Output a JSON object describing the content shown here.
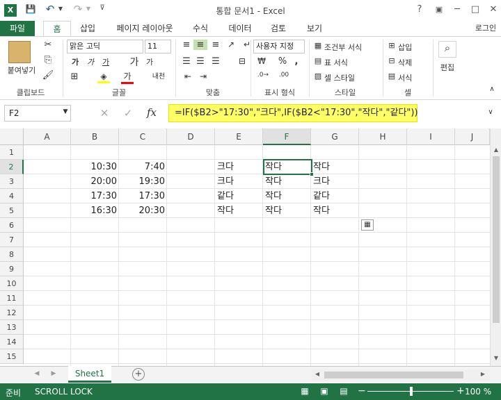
{
  "window": {
    "title": "통합 문서1 - Excel",
    "help": "?",
    "minimize": "─",
    "restore": "□",
    "close": "✕",
    "user": "로그인"
  },
  "qat": {
    "save": "💾",
    "undo": "↶",
    "redo": "↷"
  },
  "tabs": [
    "파일",
    "홈",
    "삽입",
    "페이지 레이아웃",
    "수식",
    "데이터",
    "검토",
    "보기"
  ],
  "ribbon": {
    "paste_label": "붙여넣기",
    "clipboard_group": "클립보드",
    "font_name": "맑은 고딕",
    "font_size": "11",
    "bold": "가",
    "italic": "가",
    "underline": "가",
    "grow_font": "가",
    "shrink_font": "가",
    "font_color": "가",
    "phonetic": "내천",
    "font_group": "글꼴",
    "align_group": "맞춤",
    "number_format": "사용자 지정",
    "percent": "%",
    "comma": ",",
    "number_group": "표시 형식",
    "cond_format": "조건부 서식",
    "table_format": "표 서식",
    "cell_style": "셀 스타일",
    "style_group": "스타일",
    "insert": "삽입",
    "delete": "삭제",
    "format": "서식",
    "cells_group": "셀",
    "edit": "편집"
  },
  "formula_bar": {
    "name_box": "F2",
    "cancel": "✕",
    "enter": "✓",
    "fx": "fx",
    "formula": "=IF($B2>\"17:30\",\"크다\",IF($B2<\"17:30\",\"작다\",\"같다\"))"
  },
  "columns": [
    "A",
    "B",
    "C",
    "D",
    "E",
    "F",
    "G",
    "H",
    "I",
    "J"
  ],
  "rows": [
    "1",
    "2",
    "3",
    "4",
    "5",
    "6",
    "7",
    "8",
    "9",
    "10",
    "11",
    "12",
    "13",
    "14",
    "15"
  ],
  "cells": {
    "B2": "10:30",
    "C2": "7:40",
    "E2": "크다",
    "F2": "작다",
    "G2": "작다",
    "B3": "20:00",
    "C3": "19:30",
    "E3": "크다",
    "F3": "작다",
    "G3": "크다",
    "B4": "17:30",
    "C4": "17:30",
    "E4": "같다",
    "F4": "작다",
    "G4": "같다",
    "B5": "16:30",
    "C5": "20:30",
    "E5": "작다",
    "F5": "작다",
    "G5": "작다"
  },
  "sheet_tab": "Sheet1",
  "add_sheet": "+",
  "status": {
    "ready": "준비",
    "scroll_lock": "SCROLL LOCK",
    "zoom": "100 %",
    "zoom_out": "−",
    "zoom_in": "+"
  },
  "colors": {
    "accent": "#217346",
    "formula_highlight": "#ffff66",
    "selection": "#217346"
  }
}
